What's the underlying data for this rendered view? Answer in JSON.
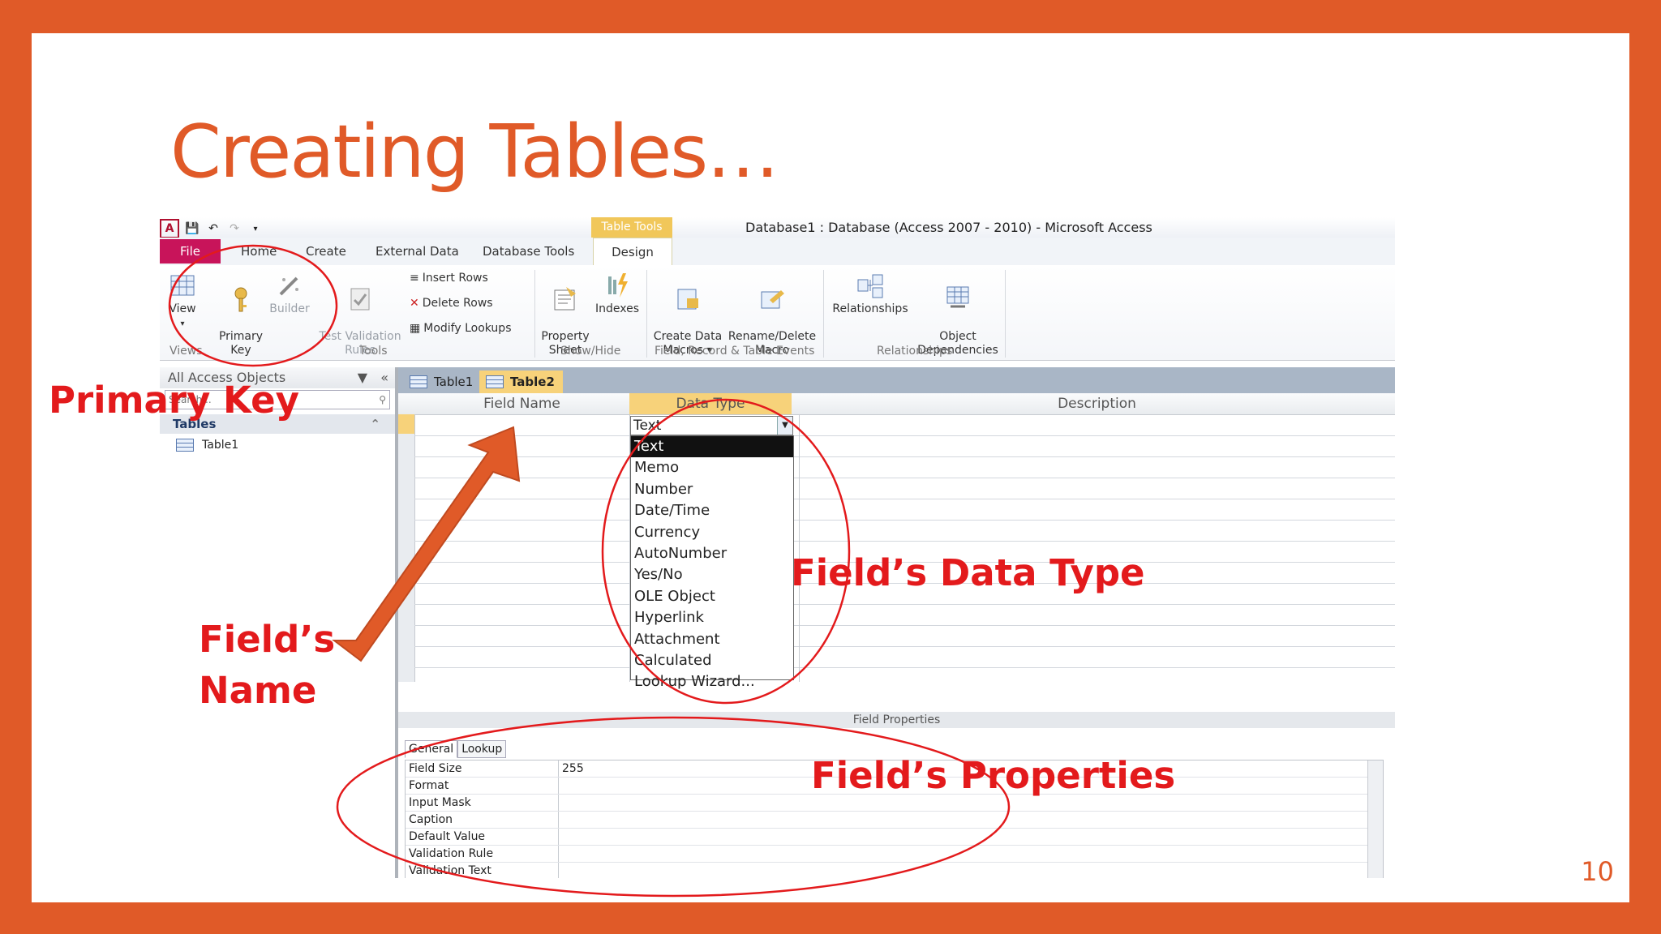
{
  "slide": {
    "title": "Creating Tables…",
    "page_number": "10"
  },
  "app": {
    "context_tab": "Table Tools",
    "window_title": "Database1 : Database (Access 2007 - 2010)  -  Microsoft Access",
    "tabs": [
      "File",
      "Home",
      "Create",
      "External Data",
      "Database Tools",
      "Design"
    ],
    "ribbon": {
      "view_label": "View",
      "primary_key_label": "Primary\nKey",
      "builder_label": "Builder",
      "test_validation_label": "Test Validation\nRules",
      "insert_rows": "Insert Rows",
      "delete_rows": "Delete Rows",
      "modify_lookups": "Modify Lookups",
      "property_sheet": "Property\nSheet",
      "indexes": "Indexes",
      "create_data_macros": "Create Data\nMacros ▾",
      "rename_delete_macro": "Rename/Delete\nMacro",
      "relationships": "Relationships",
      "object_dependencies": "Object\nDependencies",
      "groups": [
        "Views",
        "Tools",
        "Show/Hide",
        "Field, Record & Table Events",
        "Relationships"
      ]
    },
    "nav": {
      "header": "All Access Objects",
      "search_placeholder": "Search...",
      "group": "Tables",
      "items": [
        "Table1"
      ]
    },
    "doc_tabs": [
      "Table1",
      "Table2"
    ],
    "grid": {
      "columns": [
        "Field Name",
        "Data Type",
        "Description"
      ],
      "current_type": "Text",
      "type_options": [
        "Text",
        "Memo",
        "Number",
        "Date/Time",
        "Currency",
        "AutoNumber",
        "Yes/No",
        "OLE Object",
        "Hyperlink",
        "Attachment",
        "Calculated",
        "Lookup Wizard..."
      ]
    },
    "field_properties": {
      "label": "Field Properties",
      "tabs": [
        "General",
        "Lookup"
      ],
      "rows": [
        {
          "name": "Field Size",
          "value": "255"
        },
        {
          "name": "Format",
          "value": ""
        },
        {
          "name": "Input Mask",
          "value": ""
        },
        {
          "name": "Caption",
          "value": ""
        },
        {
          "name": "Default Value",
          "value": ""
        },
        {
          "name": "Validation Rule",
          "value": ""
        },
        {
          "name": "Validation Text",
          "value": ""
        }
      ]
    }
  },
  "annotations": {
    "primary_key": "Primary Key",
    "field_name_line1": "Field’s",
    "field_name_line2": "Name",
    "data_type": "Field’s Data Type",
    "properties": "Field’s Properties"
  },
  "colors": {
    "accent": "#e05a28",
    "annotation": "#e31a1c",
    "arrow": "#e05a28"
  }
}
